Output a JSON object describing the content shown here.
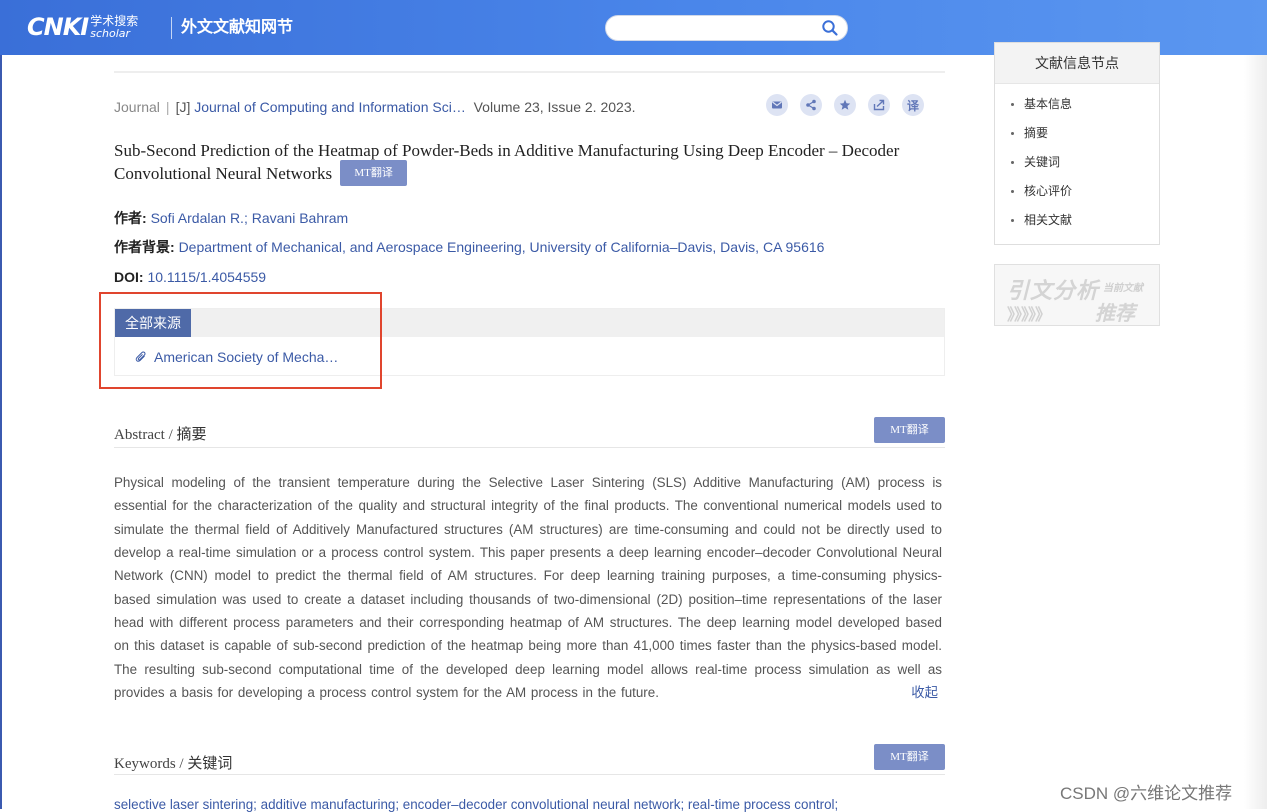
{
  "header": {
    "logo_main": "CNKI",
    "logo_cn": "学术搜索",
    "logo_en": "scholar",
    "site_title": "外文文献知网节",
    "search_value": ""
  },
  "meta": {
    "type": "Journal",
    "tag": "[J]",
    "journal": "Journal of Computing and Information Sci…",
    "volume": "Volume 23, Issue 2. 2023."
  },
  "actions": [
    {
      "name": "email-icon"
    },
    {
      "name": "share-icon"
    },
    {
      "name": "star-icon"
    },
    {
      "name": "export-icon"
    },
    {
      "name": "translate-icon",
      "label": "译"
    }
  ],
  "article": {
    "title": "Sub-Second Prediction of the Heatmap of Powder-Beds in Additive Manufacturing Using Deep Encoder – Decoder Convolutional Neural Networks",
    "mt_label": "MT翻译",
    "authors_label": "作者:",
    "authors": "Sofi Ardalan R.; Ravani Bahram",
    "background_label": "作者背景:",
    "background": "Department of Mechanical, and Aerospace Engineering, University of California–Davis, Davis, CA 95616",
    "doi_label": "DOI:",
    "doi": "10.1115/1.4054559"
  },
  "sources": {
    "tab_label": "全部来源",
    "items": [
      "American Society of Mecha…"
    ]
  },
  "abstract": {
    "title_en": "Abstract",
    "slash": " / ",
    "title_cn": "摘要",
    "mt_label": "MT翻译",
    "text": "Physical modeling of the transient temperature during the Selective Laser Sintering (SLS) Additive Manufacturing (AM) process is essential for the characterization of the quality and structural integrity of the final products. The conventional numerical models used to simulate the thermal field of Additively Manufactured structures (AM structures) are time-consuming and could not be directly used to develop a real-time simulation or a process control system. This paper presents a deep learning encoder–decoder Convolutional Neural Network (CNN) model to predict the thermal field of AM structures. For deep learning training purposes, a time-consuming physics-based simulation was used to create a dataset including thousands of two-dimensional (2D) position–time representations of the laser head with different process parameters and their corresponding heatmap of AM structures. The deep learning model developed based on this dataset is capable of sub-second prediction of the heatmap being more than 41,000 times faster than the physics-based model. The resulting sub-second computational time of the developed deep learning model allows real-time process simulation as well as provides a basis for developing a process control system for the AM process in the future.",
    "collapse_label": "收起"
  },
  "keywords": {
    "title_en": "Keywords",
    "slash": " / ",
    "title_cn": "关键词",
    "mt_label": "MT翻译",
    "text": "selective laser sintering; additive manufacturing; encoder–decoder convolutional neural network; real-time process control;"
  },
  "sidebar": {
    "title": "文献信息节点",
    "items": [
      "基本信息",
      "摘要",
      "关键词",
      "核心评价",
      "相关文献"
    ]
  },
  "recommend_banner": {
    "main": "引文分析",
    "small": "当前文献",
    "tui": "推荐",
    "arrows": "》》》》》"
  },
  "watermark": "CSDN @六维论文推荐",
  "colors": {
    "header_blue": "#4a86ea",
    "link_blue": "#3b5aa6",
    "mt_button": "#7b8ec7",
    "source_tab": "#4f6aa8",
    "highlight_red": "#e0452e"
  }
}
